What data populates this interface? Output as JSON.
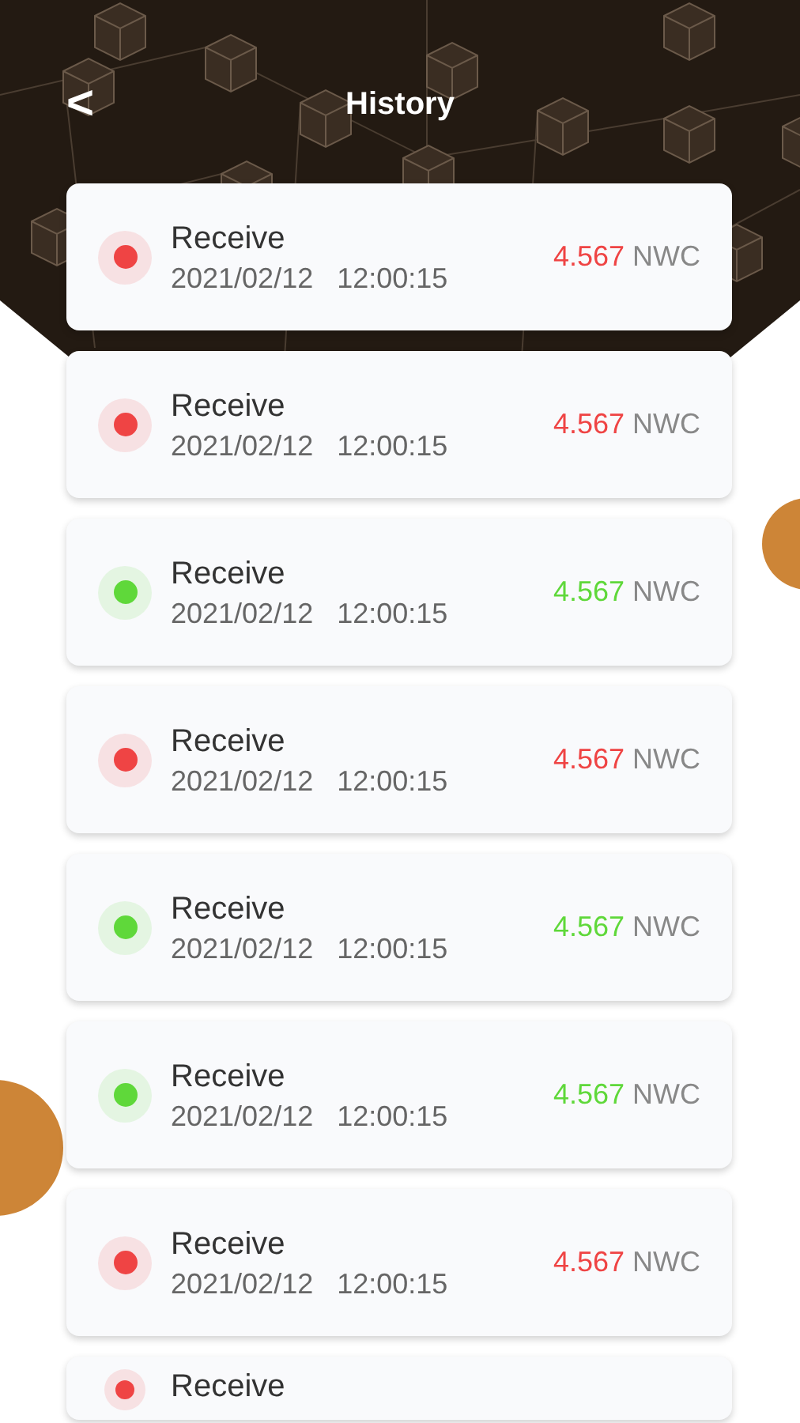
{
  "header": {
    "back": "<",
    "title": "History"
  },
  "transactions": [
    {
      "type": "Receive",
      "date": "2021/02/12",
      "time": "12:00:15",
      "amount": "4.567",
      "unit": "NWC",
      "color": "#ef4444"
    },
    {
      "type": "Receive",
      "date": "2021/02/12",
      "time": "12:00:15",
      "amount": "4.567",
      "unit": "NWC",
      "color": "#ef4444"
    },
    {
      "type": "Receive",
      "date": "2021/02/12",
      "time": "12:00:15",
      "amount": "4.567",
      "unit": "NWC",
      "color": "#5fd83a"
    },
    {
      "type": "Receive",
      "date": "2021/02/12",
      "time": "12:00:15",
      "amount": "4.567",
      "unit": "NWC",
      "color": "#ef4444"
    },
    {
      "type": "Receive",
      "date": "2021/02/12",
      "time": "12:00:15",
      "amount": "4.567",
      "unit": "NWC",
      "color": "#5fd83a"
    },
    {
      "type": "Receive",
      "date": "2021/02/12",
      "time": "12:00:15",
      "amount": "4.567",
      "unit": "NWC",
      "color": "#5fd83a"
    },
    {
      "type": "Receive",
      "date": "2021/02/12",
      "time": "12:00:15",
      "amount": "4.567",
      "unit": "NWC",
      "color": "#ef4444"
    },
    {
      "type": "Receive",
      "color": "#ef4444"
    }
  ]
}
